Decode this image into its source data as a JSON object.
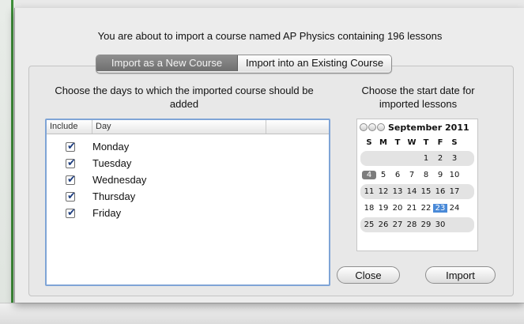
{
  "dialog": {
    "title": "You are about to import a course named AP Physics containing 196 lessons",
    "tabs": [
      {
        "label": "Import as a New Course",
        "active": true
      },
      {
        "label": "Import into an Existing Course",
        "active": false
      }
    ]
  },
  "days_section": {
    "heading": "Choose the days to which the imported course should be added",
    "columns": [
      "Include",
      "Day"
    ],
    "rows": [
      {
        "day": "Monday",
        "included": true
      },
      {
        "day": "Tuesday",
        "included": true
      },
      {
        "day": "Wednesday",
        "included": true
      },
      {
        "day": "Thursday",
        "included": true
      },
      {
        "day": "Friday",
        "included": true
      }
    ]
  },
  "date_section": {
    "heading": "Choose the start date for imported lessons",
    "month_label": "September 2011",
    "weekdays": [
      "S",
      "M",
      "T",
      "W",
      "T",
      "F",
      "S"
    ],
    "weeks": [
      [
        "",
        "",
        "",
        "",
        "1",
        "2",
        "3"
      ],
      [
        "4",
        "5",
        "6",
        "7",
        "8",
        "9",
        "10"
      ],
      [
        "11",
        "12",
        "13",
        "14",
        "15",
        "16",
        "17"
      ],
      [
        "18",
        "19",
        "20",
        "21",
        "22",
        "23",
        "24"
      ],
      [
        "25",
        "26",
        "27",
        "28",
        "29",
        "30",
        ""
      ]
    ],
    "today": "4",
    "selected": "23"
  },
  "buttons": {
    "close_label": "Close",
    "import_label": "Import"
  },
  "colors": {
    "selected_date": "#4a8ad8",
    "table_focus_border": "#7fa4d6",
    "active_tab": "#7a7a7a"
  }
}
